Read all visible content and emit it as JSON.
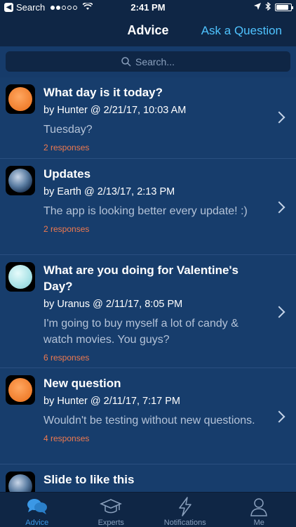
{
  "status": {
    "back_label": "Search",
    "time": "2:41 PM"
  },
  "nav": {
    "title": "Advice",
    "ask_label": "Ask a Question"
  },
  "search": {
    "placeholder": "Search..."
  },
  "posts": [
    {
      "avatar": "sun-avatar",
      "title": "What day is it today?",
      "meta": "by Hunter @ 2/21/17, 10:03 AM",
      "text": "Tuesday?",
      "responses": "2 responses"
    },
    {
      "avatar": "earth-avatar",
      "title": "Updates",
      "meta": "by Earth @ 2/13/17, 2:13 PM",
      "text": "The app is looking better every update! :)",
      "responses": "2 responses"
    },
    {
      "avatar": "uranus-avatar",
      "title": "What are you doing for Valentine's Day?",
      "meta": "by Uranus @ 2/11/17, 8:05 PM",
      "text": "I'm going to buy myself a lot of candy & watch movies. You guys?",
      "responses": "6 responses"
    },
    {
      "avatar": "sun-avatar",
      "title": "New question",
      "meta": "by Hunter @ 2/11/17, 7:17 PM",
      "text": "Wouldn't be testing without new questions.",
      "responses": "4 responses"
    },
    {
      "avatar": "earth-avatar",
      "title": "Slide to like this",
      "meta": "",
      "text": "",
      "responses": ""
    }
  ],
  "tabs": [
    {
      "label": "Advice",
      "icon": "chat-bubbles-icon",
      "active": true
    },
    {
      "label": "Experts",
      "icon": "graduation-cap-icon",
      "active": false
    },
    {
      "label": "Notifications",
      "icon": "lightning-icon",
      "active": false
    },
    {
      "label": "Me",
      "icon": "person-icon",
      "active": false
    }
  ],
  "colors": {
    "background": "#173d6c",
    "bar": "#0f2645",
    "accent": "#4fc3ff",
    "active_tab": "#3b98e6",
    "responses": "#f07a4f"
  },
  "battery_level": 0.85
}
